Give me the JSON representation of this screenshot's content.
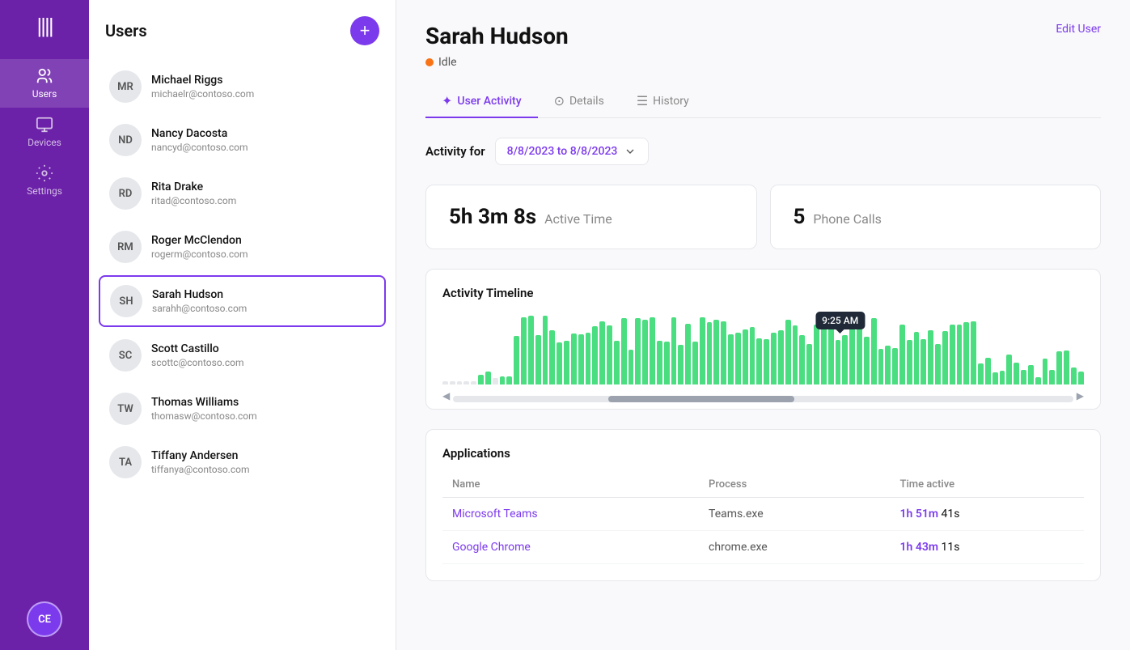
{
  "sidebar": {
    "logo": "||||",
    "nav_items": [
      {
        "id": "users",
        "label": "Users",
        "active": true
      },
      {
        "id": "devices",
        "label": "Devices",
        "active": false
      },
      {
        "id": "settings",
        "label": "Settings",
        "active": false
      }
    ],
    "user_avatar": "CE"
  },
  "users_panel": {
    "title": "Users",
    "add_button_label": "+",
    "users": [
      {
        "initials": "MR",
        "name": "Michael Riggs",
        "email": "michaelr@contoso.com",
        "selected": false
      },
      {
        "initials": "ND",
        "name": "Nancy Dacosta",
        "email": "nancyd@contoso.com",
        "selected": false
      },
      {
        "initials": "RD",
        "name": "Rita Drake",
        "email": "ritad@contoso.com",
        "selected": false
      },
      {
        "initials": "RM",
        "name": "Roger McClendon",
        "email": "rogerm@contoso.com",
        "selected": false
      },
      {
        "initials": "SH",
        "name": "Sarah Hudson",
        "email": "sarahh@contoso.com",
        "selected": true
      },
      {
        "initials": "SC",
        "name": "Scott Castillo",
        "email": "scottc@contoso.com",
        "selected": false
      },
      {
        "initials": "TW",
        "name": "Thomas Williams",
        "email": "thomasw@contoso.com",
        "selected": false
      },
      {
        "initials": "TA",
        "name": "Tiffany Andersen",
        "email": "tiffanya@contoso.com",
        "selected": false
      }
    ]
  },
  "main": {
    "user_name": "Sarah Hudson",
    "edit_link": "Edit User",
    "status": "Idle",
    "tabs": [
      {
        "id": "user-activity",
        "label": "User Activity",
        "active": true
      },
      {
        "id": "details",
        "label": "Details",
        "active": false
      },
      {
        "id": "history",
        "label": "History",
        "active": false
      }
    ],
    "activity_for_label": "Activity for",
    "date_range": "8/8/2023  to  8/8/2023",
    "stats": {
      "active_time_value": "5h 3m 8s",
      "active_time_label": "Active Time",
      "phone_calls_value": "5",
      "phone_calls_label": "Phone Calls"
    },
    "timeline": {
      "title": "Activity Timeline",
      "tooltip": "9:25 AM"
    },
    "applications": {
      "title": "Applications",
      "columns": [
        "Name",
        "Process",
        "Time active"
      ],
      "rows": [
        {
          "name": "Microsoft Teams",
          "process": "Teams.exe",
          "time": "1h 51m 41s",
          "highlight": "1h 51m"
        },
        {
          "name": "Google Chrome",
          "process": "chrome.exe",
          "time": "1h 43m 11s",
          "highlight": "1h 43m"
        }
      ]
    }
  }
}
